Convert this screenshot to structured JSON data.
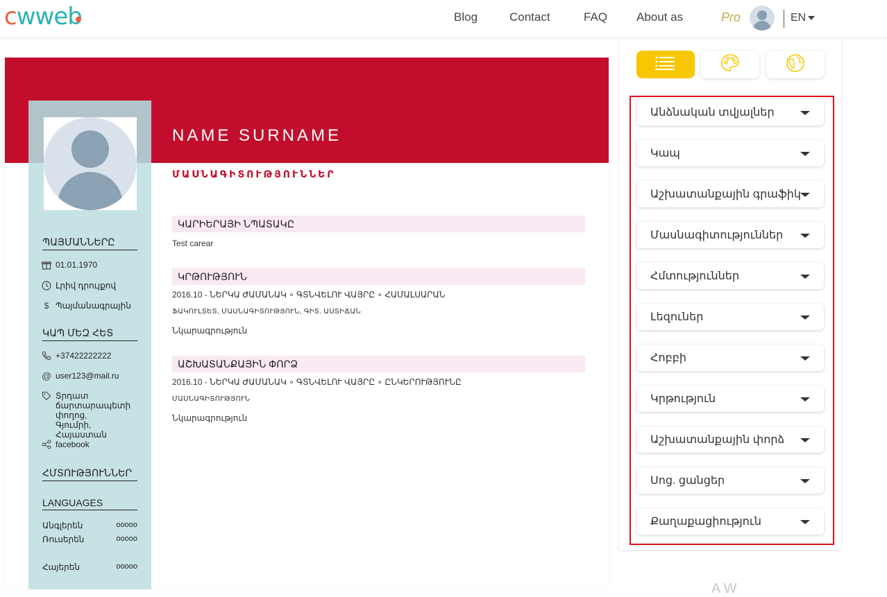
{
  "header": {
    "logo": {
      "c": "c",
      "w": "w",
      "web": "web"
    },
    "nav": [
      "Blog",
      "Contact",
      "FAQ",
      "About as"
    ],
    "pro": "Pro",
    "lang": "EN"
  },
  "resume": {
    "name": "NAME SURNAME",
    "profession": "ՄԱՍՆԱԳԻՏՈՒԹՅՈՒՆՆԵՐ",
    "sidebar": {
      "details_title": "ՊԱՅՄԱՆՆԵՐԸ",
      "details": [
        {
          "icon": "gift-icon",
          "text": "01.01.1970"
        },
        {
          "icon": "clock-icon",
          "text": "Լրիվ դրույքով"
        },
        {
          "icon": "dollar-icon",
          "text": "Պայմանագրային"
        }
      ],
      "contact_title": "ԿԱՊ ՄԵԶ ՀԵՏ",
      "contacts": [
        {
          "icon": "phone-icon",
          "text": "+37422222222"
        },
        {
          "icon": "at-icon",
          "text": "user123@mail.ru"
        },
        {
          "icon": "tag-icon",
          "text": "Տրդատ ճարտարապետի փողոց, Գյումրի, Հայաստան"
        },
        {
          "icon": "share-icon",
          "text": "facebook"
        }
      ],
      "skills_title": "ՀՄՏՈՒԹՅՈՒՆՆԵՐ",
      "languages_title": "LANGUAGES",
      "languages": [
        {
          "name": "Անգլերեն",
          "level": "ooooo"
        },
        {
          "name": "Ռուսերեն",
          "level": "ooooo"
        },
        {
          "name": "Հայերեն",
          "level": "ooooo"
        }
      ]
    },
    "main": {
      "career_title": "ԿԱՐԻԵՐԱՅԻ ՆՊԱՏԱԿԸ",
      "career_text": "Test carear",
      "education_title": "ԿՐԹՈՒԹՅՈՒՆ",
      "education_line1": "2016.10 - ՆԵՐԿԱ ԺԱՄԱՆԱԿ  ∘  ԳՏՆՎԵԼՈՒ ՎԱՅՐԸ  ∘  ՀԱՄԱԼՍԱՐԱՆ",
      "education_line2": "ՖԱԿՈՒԼՏԵՏ, ՄԱՍՆԱԳԻՏՈՒԹՅՈՒՆ, ԳԻՏ. ԱՍՏԻՃԱՆ",
      "education_desc": "Նկարագրություն",
      "work_title": "ԱՇԽԱՏԱՆՔԱՅԻՆ ՓՈՐՁ",
      "work_line1": "2016.10 - ՆԵՐԿԱ ԺԱՄԱՆԱԿ  ∘  ԳՏՆՎԵԼՈՒ ՎԱՅՐԸ  ∘  ԸՆԿԵՐՈՒԹՅՈՒՆԸ",
      "work_line2": "ՄԱՍՆԱԳԻՏՈՒԹՅՈՒՆ",
      "work_desc": "Նկարագրություն"
    }
  },
  "editor": {
    "tabs": [
      "list-icon",
      "palette-icon",
      "globe-icon"
    ],
    "sections": [
      "Անձնական տվյալներ",
      "Կապ",
      "Աշխատանքային գրաֆիկ",
      "Մասնագիտություններ",
      "Հմտություններ",
      "Լեզուներ",
      "Հոբբի",
      "Կրթություն",
      "Աշխատանքային փորձ",
      "Սոց. ցանցեր",
      "Քաղաքացիություն"
    ]
  },
  "footer_ghost": "A   W"
}
